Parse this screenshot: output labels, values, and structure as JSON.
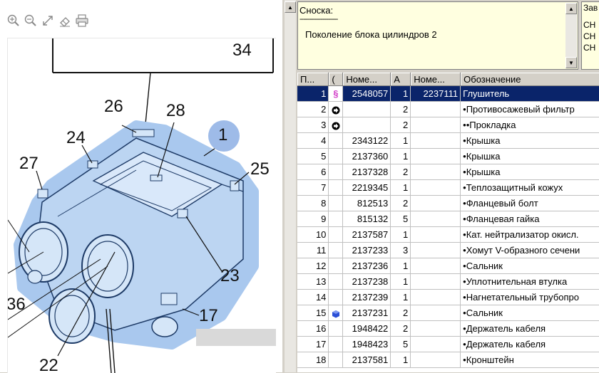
{
  "toolbar": {
    "icons": [
      "zoom-in-icon",
      "zoom-out-icon",
      "fit-icon",
      "eraser-icon",
      "printer-icon"
    ]
  },
  "diagram": {
    "callouts": [
      "34",
      "26",
      "28",
      "1",
      "24",
      "27",
      "25",
      "23",
      "36",
      "17",
      "22"
    ],
    "selected_callout": "1"
  },
  "footnote": {
    "title": "Сноска:",
    "dashes": "--------------------",
    "text": "Поколение блока цилиндров 2"
  },
  "right_panel": {
    "header": "Зав",
    "lines": [
      "CH",
      "CH",
      "CH"
    ]
  },
  "table": {
    "headers": [
      "П...",
      "(",
      "Номе...",
      "А",
      "Номе...",
      "Обозначение"
    ],
    "rows": [
      {
        "pos": "1",
        "mark": "§",
        "num": "2548057",
        "qty": "1",
        "num2": "2237111",
        "name": "Глушитель",
        "selected": true
      },
      {
        "pos": "2",
        "mark": "arrow",
        "num": "",
        "qty": "2",
        "num2": "",
        "name": "•Противосажевый фильтр"
      },
      {
        "pos": "3",
        "mark": "arrow",
        "num": "",
        "qty": "2",
        "num2": "",
        "name": "••Прокладка"
      },
      {
        "pos": "4",
        "mark": "",
        "num": "2343122",
        "qty": "1",
        "num2": "",
        "name": "•Крышка"
      },
      {
        "pos": "5",
        "mark": "",
        "num": "2137360",
        "qty": "1",
        "num2": "",
        "name": "•Крышка"
      },
      {
        "pos": "6",
        "mark": "",
        "num": "2137328",
        "qty": "2",
        "num2": "",
        "name": "•Крышка"
      },
      {
        "pos": "7",
        "mark": "",
        "num": "2219345",
        "qty": "1",
        "num2": "",
        "name": "•Теплозащитный кожух"
      },
      {
        "pos": "8",
        "mark": "",
        "num": "812513",
        "qty": "2",
        "num2": "",
        "name": "•Фланцевый болт"
      },
      {
        "pos": "9",
        "mark": "",
        "num": "815132",
        "qty": "5",
        "num2": "",
        "name": "•Фланцевая гайка"
      },
      {
        "pos": "10",
        "mark": "",
        "num": "2137587",
        "qty": "1",
        "num2": "",
        "name": "•Кат. нейтрализатор окисл."
      },
      {
        "pos": "11",
        "mark": "",
        "num": "2137233",
        "qty": "3",
        "num2": "",
        "name": "•Хомут V-образного сечени"
      },
      {
        "pos": "12",
        "mark": "",
        "num": "2137236",
        "qty": "1",
        "num2": "",
        "name": "•Сальник"
      },
      {
        "pos": "13",
        "mark": "",
        "num": "2137238",
        "qty": "1",
        "num2": "",
        "name": "•Уплотнительная втулка"
      },
      {
        "pos": "14",
        "mark": "",
        "num": "2137239",
        "qty": "1",
        "num2": "",
        "name": "•Нагнетательный трубопро"
      },
      {
        "pos": "15",
        "mark": "cube",
        "num": "2137231",
        "qty": "2",
        "num2": "",
        "name": "•Сальник"
      },
      {
        "pos": "16",
        "mark": "",
        "num": "1948422",
        "qty": "2",
        "num2": "",
        "name": "•Держатель кабеля"
      },
      {
        "pos": "17",
        "mark": "",
        "num": "1948423",
        "qty": "5",
        "num2": "",
        "name": "•Держатель кабеля"
      },
      {
        "pos": "18",
        "mark": "",
        "num": "2137581",
        "qty": "1",
        "num2": "",
        "name": "•Кронштейн"
      }
    ]
  },
  "colors": {
    "selection": "#0a246a",
    "footnote_bg": "#ffffe0",
    "diagram_highlight": "#a9c8ee",
    "callout_bubble": "#9ebbe8"
  }
}
